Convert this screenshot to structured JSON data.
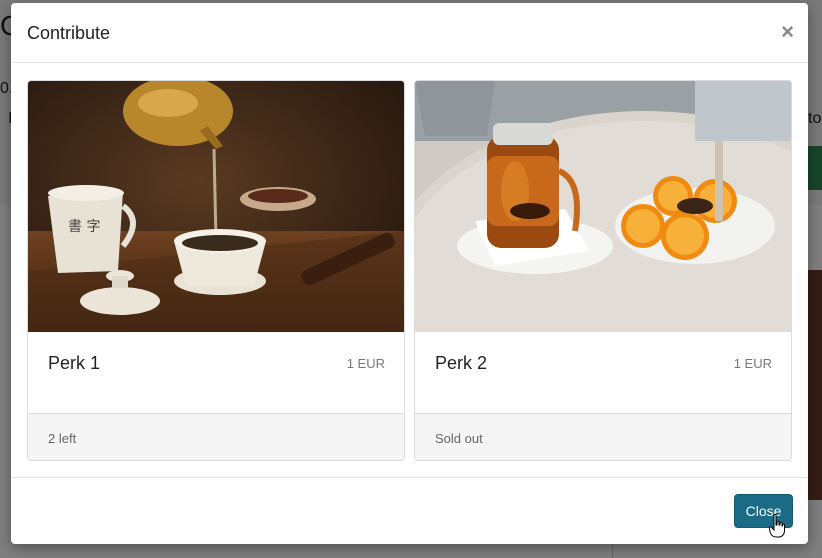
{
  "background": {
    "heading_fragment": "C",
    "text_fragment_1": "0.",
    "text_fragment_2": "I",
    "text_fragment_3": "to"
  },
  "modal": {
    "title": "Contribute",
    "close_symbol": "×",
    "perks": [
      {
        "title": "Perk 1",
        "price": "1 EUR",
        "status": "2 left",
        "image": "tea-pouring-photo"
      },
      {
        "title": "Perk 2",
        "price": "1 EUR",
        "status": "Sold out",
        "image": "iced-tea-oranges-photo"
      }
    ],
    "close_button": "Close"
  },
  "colors": {
    "accent": "#1b6a86",
    "overlay": "rgba(0,0,0,0.5)"
  }
}
